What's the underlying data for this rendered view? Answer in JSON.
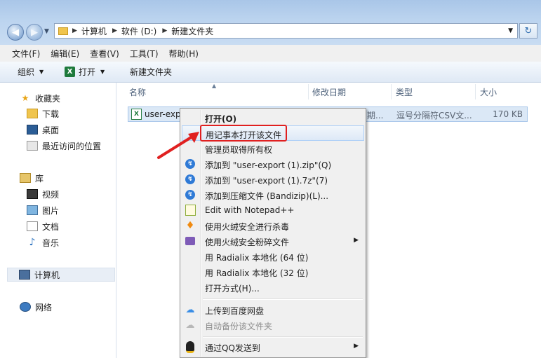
{
  "address": {
    "crumbs": [
      "计算机",
      "软件 (D:)",
      "新建文件夹"
    ]
  },
  "menubar": [
    "文件(F)",
    "编辑(E)",
    "查看(V)",
    "工具(T)",
    "帮助(H)"
  ],
  "toolbar": {
    "organize": "组织",
    "open": "打开",
    "new_folder": "新建文件夹"
  },
  "nav": {
    "favorites": "收藏夹",
    "downloads": "下载",
    "desktop": "桌面",
    "recent": "最近访问的位置",
    "libraries": "库",
    "videos": "视频",
    "pictures": "图片",
    "documents": "文档",
    "music": "音乐",
    "computer": "计算机",
    "network": "网络"
  },
  "columns": {
    "name": "名称",
    "date": "修改日期",
    "type": "类型",
    "size": "大小"
  },
  "file": {
    "name": "user-exp",
    "date": "期...",
    "type": "逗号分隔符CSV文...",
    "size": "170 KB"
  },
  "context_menu": {
    "open": "打开(O)",
    "open_notepad": "用记事本打开该文件",
    "take_ownership": "管理员取得所有权",
    "add_zip": "添加到 \"user-export (1).zip\"(Q)",
    "add_7z": "添加到 \"user-export (1).7z\"(7)",
    "add_compress": "添加到压缩文件 (Bandizip)(L)...",
    "edit_npp": "Edit with Notepad++",
    "huorong_scan": "使用火绒安全进行杀毒",
    "huorong_shred": "使用火绒安全粉碎文件",
    "radialix64": "用 Radialix 本地化 (64 位)",
    "radialix32": "用 Radialix 本地化 (32 位)",
    "open_with": "打开方式(H)...",
    "upload_baidu": "上传到百度网盘",
    "auto_backup": "自动备份该文件夹",
    "send_qq": "通过QQ发送到"
  }
}
